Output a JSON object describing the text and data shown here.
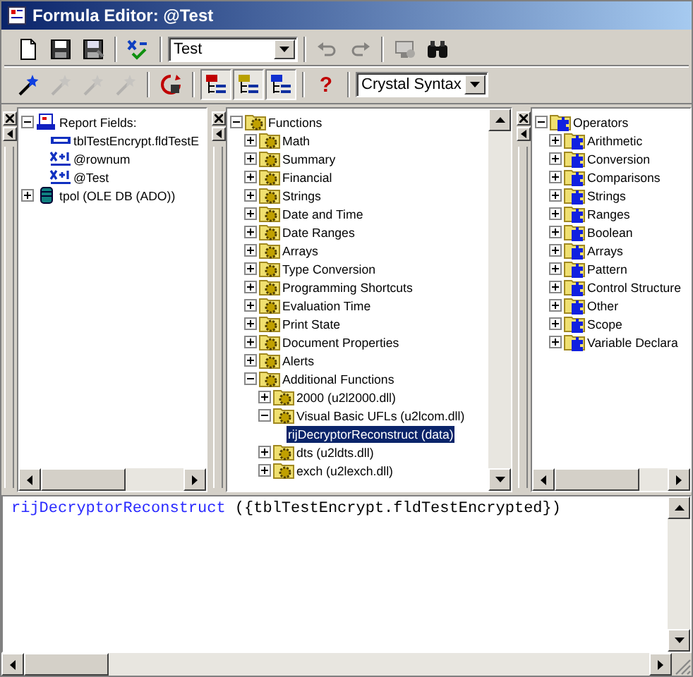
{
  "window": {
    "title": "Formula Editor: @Test"
  },
  "toolbars": [
    {
      "items": [
        {
          "kind": "new",
          "disabled": false
        },
        {
          "kind": "save",
          "disabled": false
        },
        {
          "kind": "save-close",
          "disabled": false
        },
        {
          "kind": "separator"
        },
        {
          "kind": "check",
          "disabled": false
        },
        {
          "kind": "separator"
        },
        {
          "kind": "combo",
          "value": "Test"
        },
        {
          "kind": "separator"
        },
        {
          "kind": "undo",
          "disabled": true
        },
        {
          "kind": "redo",
          "disabled": true
        },
        {
          "kind": "separator"
        },
        {
          "kind": "browse",
          "disabled": true
        },
        {
          "kind": "find",
          "disabled": false
        }
      ]
    },
    {
      "items": [
        {
          "kind": "wand",
          "disabled": false
        },
        {
          "kind": "wand",
          "disabled": true
        },
        {
          "kind": "wand",
          "disabled": true
        },
        {
          "kind": "wand",
          "disabled": true
        },
        {
          "kind": "separator"
        },
        {
          "kind": "sort",
          "disabled": false
        },
        {
          "kind": "separator"
        },
        {
          "kind": "field-tree",
          "pressed": true
        },
        {
          "kind": "function-tree",
          "pressed": true
        },
        {
          "kind": "operator-tree",
          "pressed": true
        },
        {
          "kind": "separator"
        },
        {
          "kind": "help",
          "glyph": "?"
        },
        {
          "kind": "separator"
        },
        {
          "kind": "combo",
          "value": "Crystal Syntax"
        }
      ]
    }
  ],
  "panes": [
    {
      "vertical_scrollbar": false,
      "tree": [
        {
          "label": "Report Fields:",
          "kind": "report",
          "expanded": true,
          "selected": false,
          "children": [
            {
              "label": "tblTestEncrypt.fldTestE",
              "kind": "field",
              "selected": false
            },
            {
              "label": "@rownum",
              "kind": "formula",
              "selected": false
            },
            {
              "label": "@Test",
              "kind": "formula",
              "selected": false
            }
          ]
        },
        {
          "label": "tpol (OLE DB (ADO))",
          "kind": "database",
          "expanded": false,
          "selected": false
        }
      ]
    },
    {
      "vertical_scrollbar": true,
      "tree": [
        {
          "label": "Functions",
          "kind": "gear",
          "expanded": true,
          "selected": false,
          "children": [
            {
              "label": "Math",
              "kind": "gear",
              "expanded": false,
              "selected": false
            },
            {
              "label": "Summary",
              "kind": "gear",
              "expanded": false,
              "selected": false
            },
            {
              "label": "Financial",
              "kind": "gear",
              "expanded": false,
              "selected": false
            },
            {
              "label": "Strings",
              "kind": "gear",
              "expanded": false,
              "selected": false
            },
            {
              "label": "Date and Time",
              "kind": "gear",
              "expanded": false,
              "selected": false
            },
            {
              "label": "Date Ranges",
              "kind": "gear",
              "expanded": false,
              "selected": false
            },
            {
              "label": "Arrays",
              "kind": "gear",
              "expanded": false,
              "selected": false
            },
            {
              "label": "Type Conversion",
              "kind": "gear",
              "expanded": false,
              "selected": false
            },
            {
              "label": "Programming Shortcuts",
              "kind": "gear",
              "expanded": false,
              "selected": false
            },
            {
              "label": "Evaluation Time",
              "kind": "gear",
              "expanded": false,
              "selected": false
            },
            {
              "label": "Print State",
              "kind": "gear",
              "expanded": false,
              "selected": false
            },
            {
              "label": "Document Properties",
              "kind": "gear",
              "expanded": false,
              "selected": false
            },
            {
              "label": "Alerts",
              "kind": "gear",
              "expanded": false,
              "selected": false
            },
            {
              "label": "Additional Functions",
              "kind": "gear",
              "expanded": true,
              "selected": false,
              "children": [
                {
                  "label": "2000 (u2l2000.dll)",
                  "kind": "gear",
                  "expanded": false,
                  "selected": false
                },
                {
                  "label": "Visual Basic UFLs (u2lcom.dll)",
                  "kind": "gear",
                  "expanded": true,
                  "selected": false,
                  "children": [
                    {
                      "label": "rijDecryptorReconstruct (data)",
                      "selected": true
                    }
                  ]
                },
                {
                  "label": "dts (u2ldts.dll)",
                  "kind": "gear",
                  "expanded": false,
                  "selected": false
                },
                {
                  "label": "exch (u2lexch.dll)",
                  "kind": "gear",
                  "expanded": false,
                  "selected": false
                }
              ]
            }
          ]
        }
      ]
    },
    {
      "vertical_scrollbar": false,
      "tree": [
        {
          "label": "Operators",
          "kind": "puzzle",
          "expanded": true,
          "selected": false,
          "children": [
            {
              "label": "Arithmetic",
              "kind": "puzzle",
              "expanded": false,
              "selected": false
            },
            {
              "label": "Conversion",
              "kind": "puzzle",
              "expanded": false,
              "selected": false
            },
            {
              "label": "Comparisons",
              "kind": "puzzle",
              "expanded": false,
              "selected": false
            },
            {
              "label": "Strings",
              "kind": "puzzle",
              "expanded": false,
              "selected": false
            },
            {
              "label": "Ranges",
              "kind": "puzzle",
              "expanded": false,
              "selected": false
            },
            {
              "label": "Boolean",
              "kind": "puzzle",
              "expanded": false,
              "selected": false
            },
            {
              "label": "Arrays",
              "kind": "puzzle",
              "expanded": false,
              "selected": false
            },
            {
              "label": "Pattern",
              "kind": "puzzle",
              "expanded": false,
              "selected": false
            },
            {
              "label": "Control Structure",
              "kind": "puzzle",
              "expanded": false,
              "selected": false
            },
            {
              "label": "Other",
              "kind": "puzzle",
              "expanded": false,
              "selected": false
            },
            {
              "label": "Scope",
              "kind": "puzzle",
              "expanded": false,
              "selected": false
            },
            {
              "label": "Variable Declara",
              "kind": "puzzle",
              "expanded": false,
              "selected": false
            }
          ]
        }
      ]
    }
  ],
  "editor": {
    "tokens": [
      {
        "text": "rijDecryptorReconstruct",
        "kind": "function"
      },
      {
        "text": " ({tblTestEncrypt.fldTestEncrypted})",
        "kind": "plain"
      }
    ]
  }
}
